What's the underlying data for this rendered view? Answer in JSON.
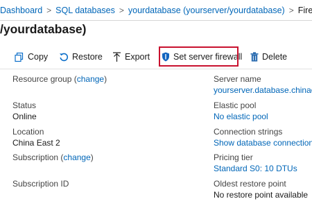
{
  "breadcrumb": {
    "items": [
      "Dashboard",
      "SQL databases",
      "yourdatabase (yourserver/yourdatabase)",
      "Firew"
    ],
    "separator": ">"
  },
  "title": "/yourdatabase)",
  "toolbar": {
    "copy_label": "Copy",
    "restore_label": "Restore",
    "export_label": "Export",
    "firewall_label": "Set server firewall",
    "delete_label": "Delete",
    "highlight_color": "#c8102e"
  },
  "essentials": {
    "left": [
      {
        "label": "Resource group",
        "change": "change",
        "value": ""
      },
      {
        "label": "Status",
        "value": "Online"
      },
      {
        "label": "Location",
        "value": "China East 2"
      },
      {
        "label": "Subscription",
        "change": "change",
        "value": ""
      },
      {
        "label": "Subscription ID",
        "value": ""
      }
    ],
    "right": [
      {
        "label": "Server name",
        "value": "yourserver.database.chinacl"
      },
      {
        "label": "Elastic pool",
        "value": "No elastic pool"
      },
      {
        "label": "Connection strings",
        "value": "Show database connection"
      },
      {
        "label": "Pricing tier",
        "value": "Standard S0: 10 DTUs"
      },
      {
        "label": "Oldest restore point",
        "value": "No restore point available"
      }
    ]
  },
  "colors": {
    "link": "#0066b8",
    "text": "#1a1a1a"
  }
}
